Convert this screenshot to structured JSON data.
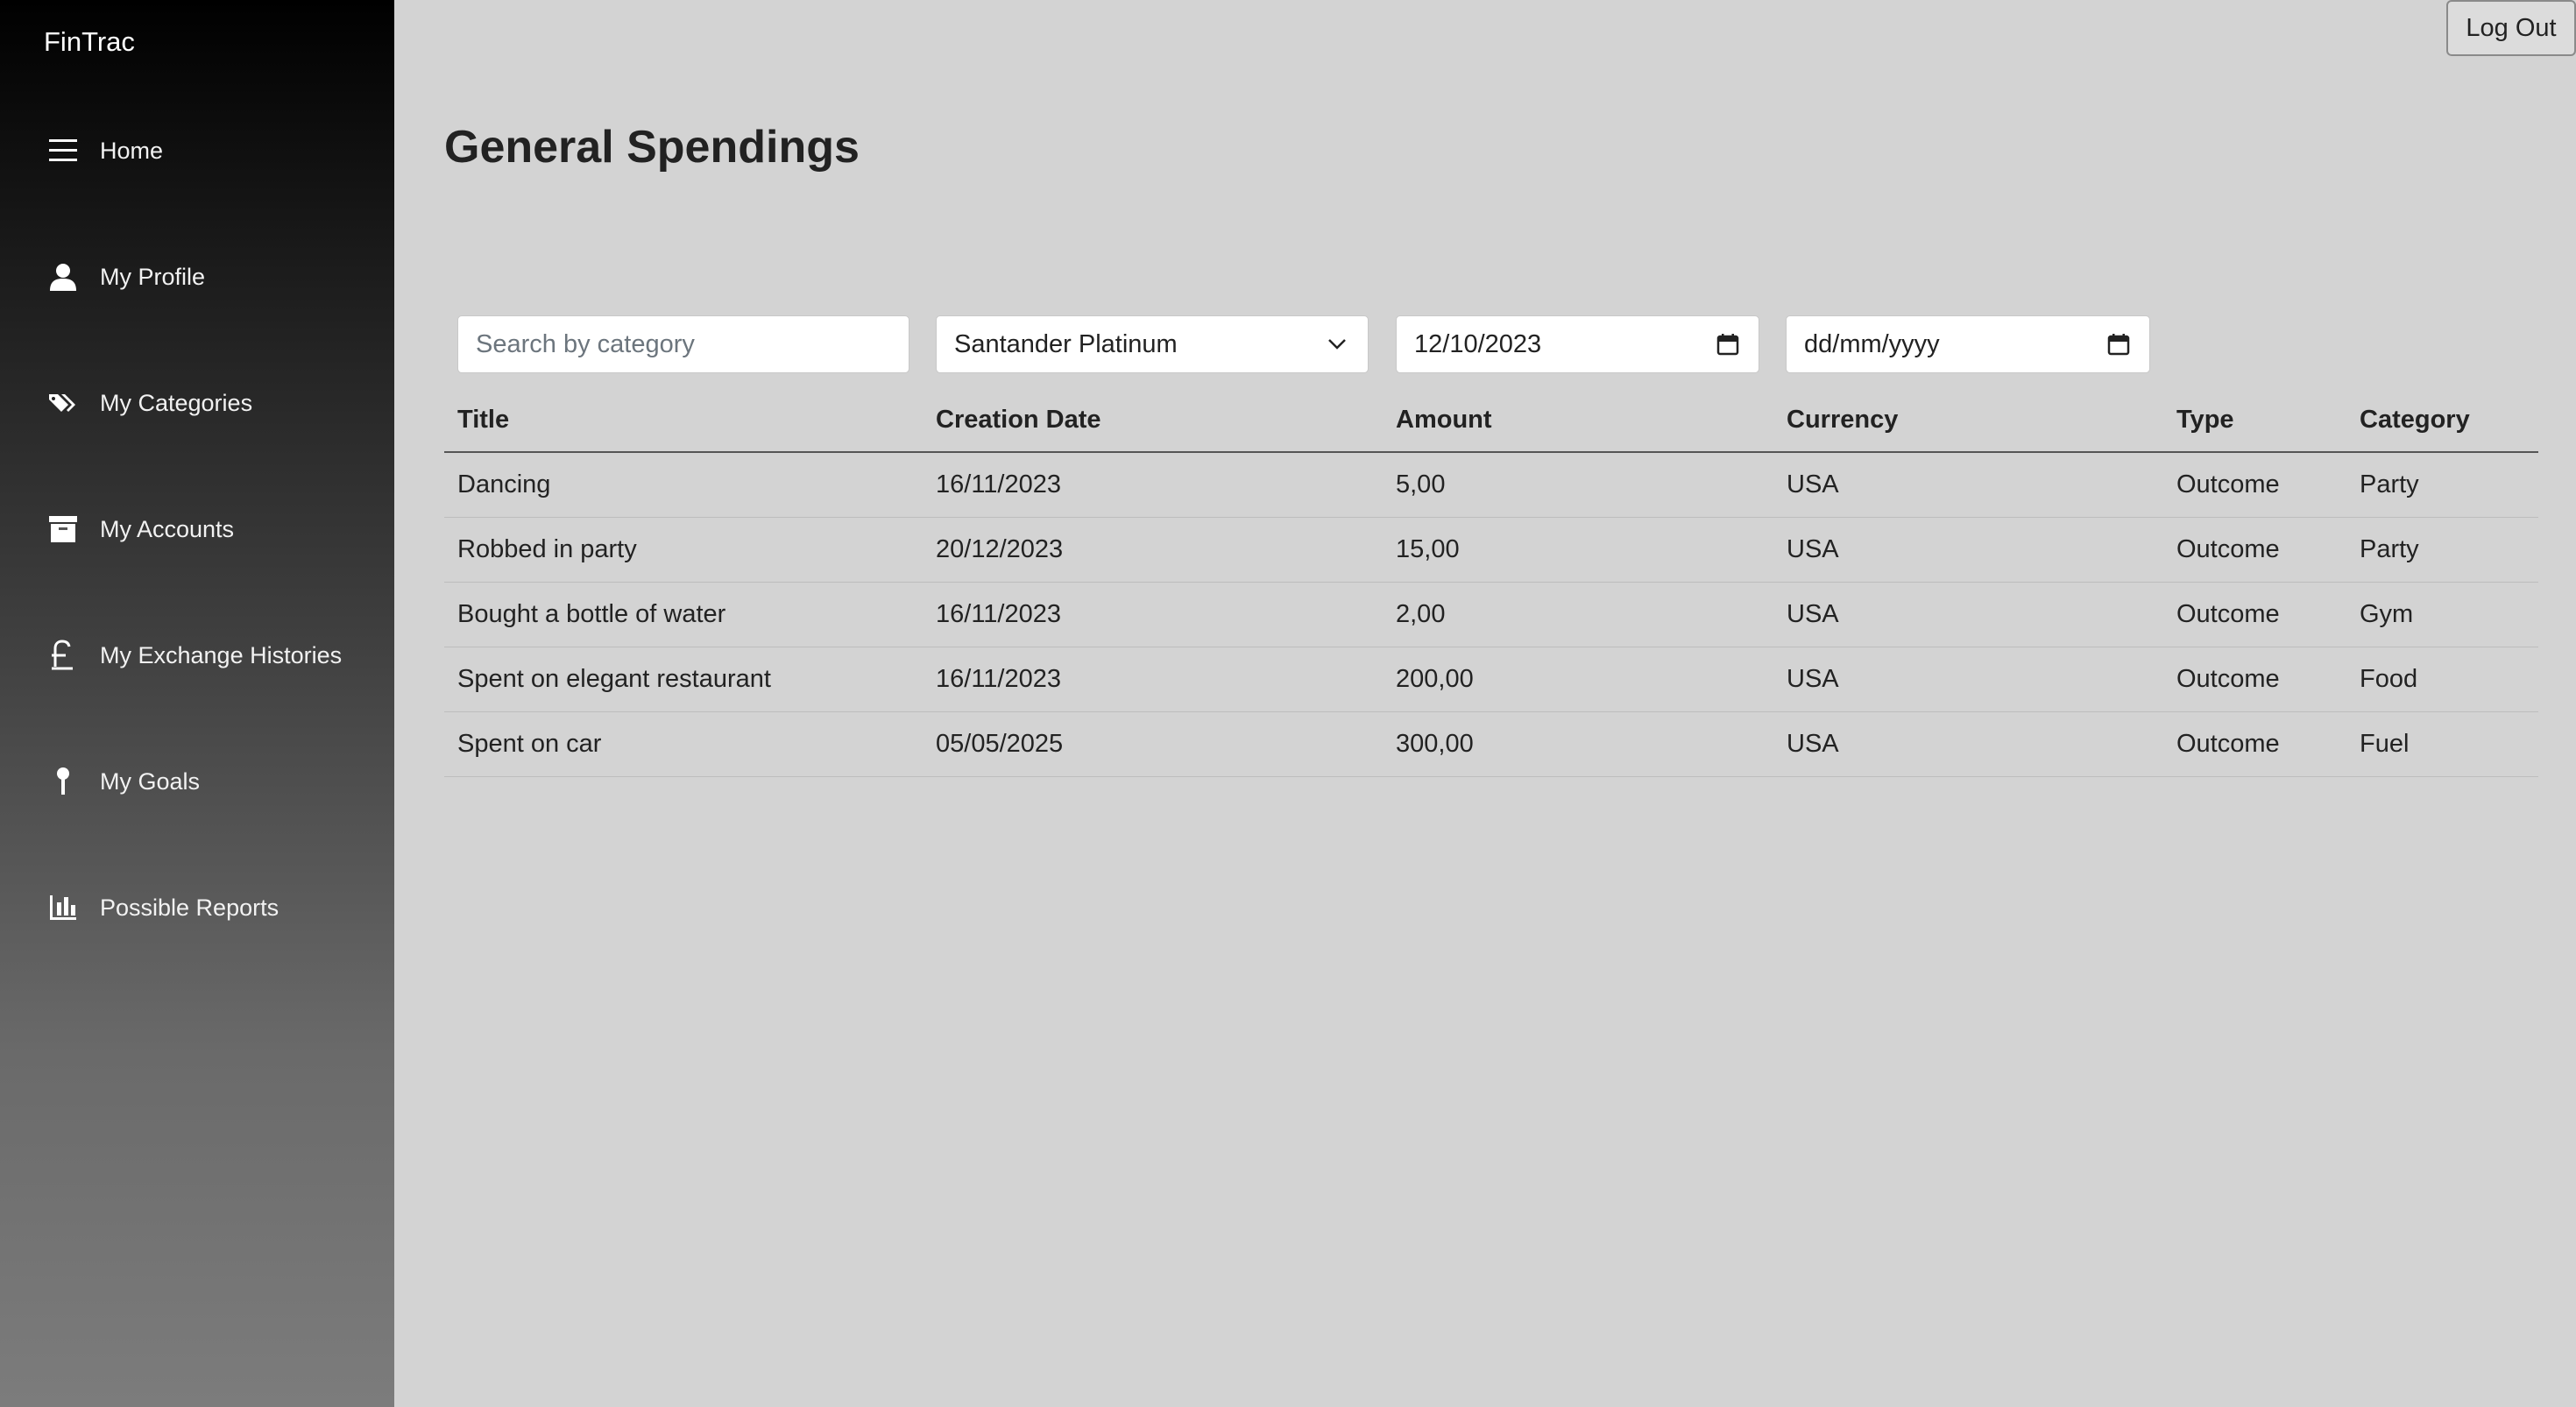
{
  "app": {
    "brand": "FinTrac"
  },
  "sidebar": {
    "items": [
      {
        "label": "Home",
        "icon": "menu-icon"
      },
      {
        "label": "My Profile",
        "icon": "user-icon"
      },
      {
        "label": "My Categories",
        "icon": "tags-icon"
      },
      {
        "label": "My Accounts",
        "icon": "archive-box-icon"
      },
      {
        "label": "My Exchange Histories",
        "icon": "pound-sign-icon"
      },
      {
        "label": "My Goals",
        "icon": "pin-icon"
      },
      {
        "label": "Possible Reports",
        "icon": "bar-chart-icon"
      }
    ]
  },
  "header": {
    "logout_label": "Log Out"
  },
  "main": {
    "title": "General Spendings",
    "filters": {
      "search_placeholder": "Search by category",
      "search_value": "",
      "account_selected": "Santander Platinum",
      "date_from": "12/10/2023",
      "date_to": "dd/mm/yyyy"
    },
    "table": {
      "columns": [
        "Title",
        "Creation Date",
        "Amount",
        "Currency",
        "Type",
        "Category"
      ],
      "rows": [
        [
          "Dancing",
          "16/11/2023",
          "5,00",
          "USA",
          "Outcome",
          "Party"
        ],
        [
          "Robbed in party",
          "20/12/2023",
          "15,00",
          "USA",
          "Outcome",
          "Party"
        ],
        [
          "Bought a bottle of water",
          "16/11/2023",
          "2,00",
          "USA",
          "Outcome",
          "Gym"
        ],
        [
          "Spent on elegant restaurant",
          "16/11/2023",
          "200,00",
          "USA",
          "Outcome",
          "Food"
        ],
        [
          "Spent on car",
          "05/05/2025",
          "300,00",
          "USA",
          "Outcome",
          "Fuel"
        ]
      ]
    }
  },
  "colors": {
    "page_background": "#d3d3d3",
    "sidebar_top": "#000000",
    "sidebar_bottom": "#7c7c7c",
    "text": "#222222"
  }
}
